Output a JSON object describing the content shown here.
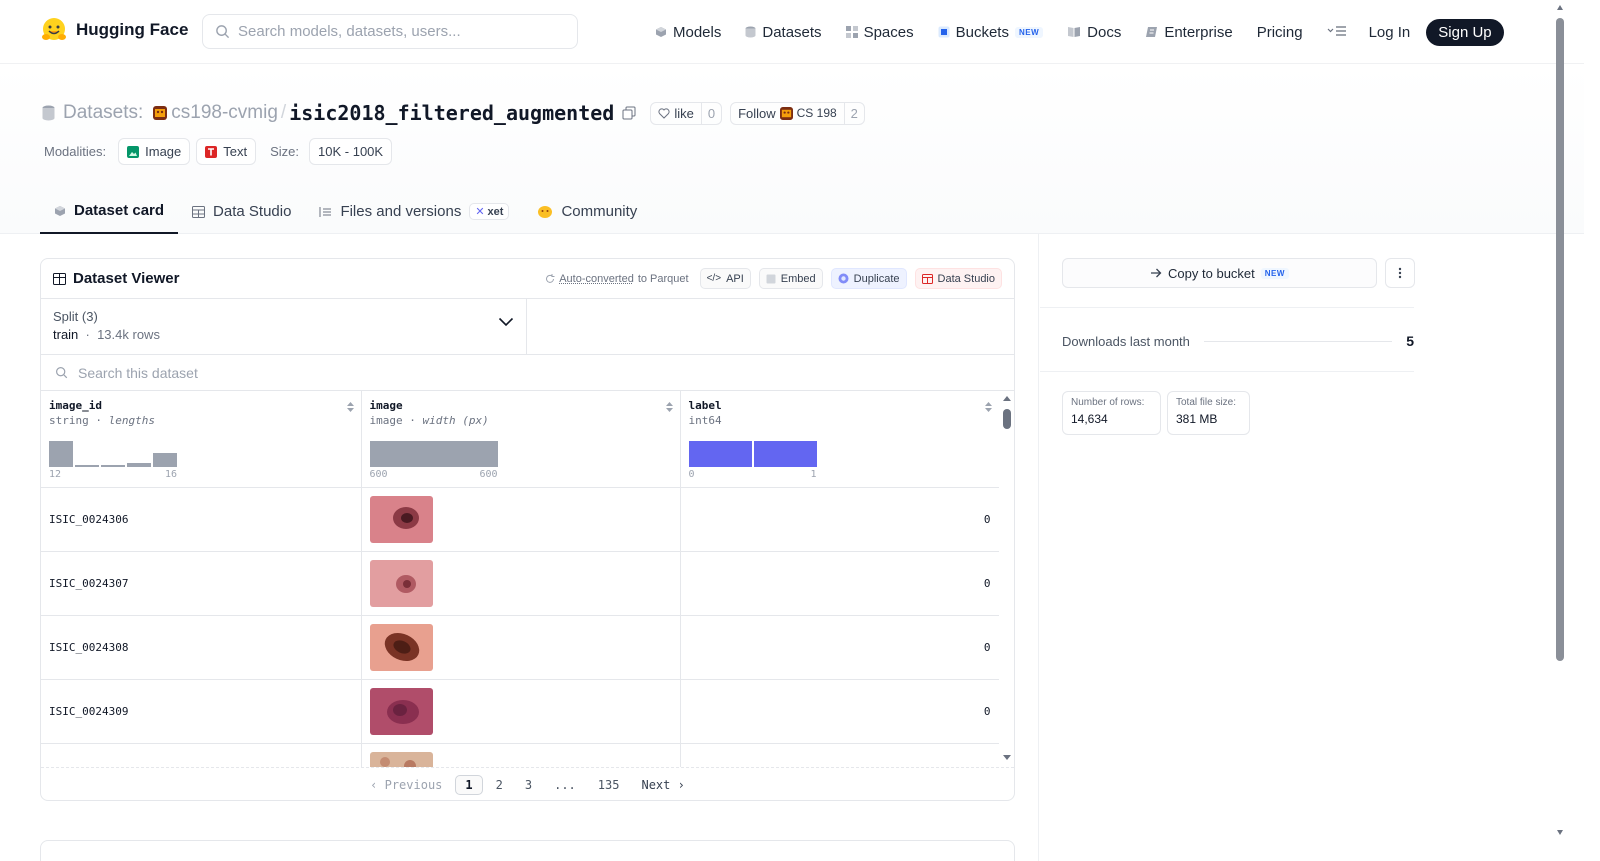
{
  "nav": {
    "brand": "Hugging Face",
    "search_placeholder": "Search models, datasets, users...",
    "links": [
      {
        "label": "Models",
        "icon": "cube-icon"
      },
      {
        "label": "Datasets",
        "icon": "database-icon"
      },
      {
        "label": "Spaces",
        "icon": "grid-icon"
      },
      {
        "label": "Buckets",
        "icon": "bucket-icon",
        "badge": "NEW"
      },
      {
        "label": "Docs",
        "icon": "book-icon"
      },
      {
        "label": "Enterprise",
        "icon": "enterprise-icon"
      },
      {
        "label": "Pricing"
      }
    ],
    "login": "Log In",
    "signup": "Sign Up"
  },
  "header": {
    "section": "Datasets:",
    "owner": "cs198-cvmig",
    "sep": "/",
    "name": "isic2018_filtered_augmented",
    "like_label": "like",
    "like_count": "0",
    "follow_label": "Follow",
    "org": "CS 198",
    "follow_count": "2",
    "modalities_label": "Modalities:",
    "modalities": [
      "Image",
      "Text"
    ],
    "size_label": "Size:",
    "size": "10K - 100K"
  },
  "tabs": [
    {
      "label": "Dataset card",
      "active": true
    },
    {
      "label": "Data Studio"
    },
    {
      "label": "Files and versions",
      "badge": "xet"
    },
    {
      "label": "Community"
    }
  ],
  "viewer": {
    "title": "Dataset Viewer",
    "auto_converted": "Auto-converted",
    "to_parquet": "to Parquet",
    "actions": [
      "API",
      "Embed",
      "Duplicate",
      "Data Studio"
    ],
    "split_label": "Split (3)",
    "split_name": "train",
    "split_rows": "13.4k rows",
    "search_placeholder": "Search this dataset",
    "columns": [
      {
        "name": "image_id",
        "type": "string",
        "stat": "lengths",
        "min": "12",
        "max": "16"
      },
      {
        "name": "image",
        "type": "image",
        "stat": "width (px)",
        "min": "600",
        "max": "600"
      },
      {
        "name": "label",
        "type": "int64",
        "stat": "",
        "min": "0",
        "max": "1"
      }
    ],
    "rows": [
      {
        "image_id": "ISIC_0024306",
        "label": "0"
      },
      {
        "image_id": "ISIC_0024307",
        "label": "0"
      },
      {
        "image_id": "ISIC_0024308",
        "label": "0"
      },
      {
        "image_id": "ISIC_0024309",
        "label": "0"
      },
      {
        "image_id": "",
        "label": ""
      }
    ],
    "pager": {
      "prev": "Previous",
      "pages": [
        "1",
        "2",
        "3",
        "...",
        "135"
      ],
      "next": "Next",
      "current": "1"
    }
  },
  "sidebar": {
    "copy_bucket": "Copy to bucket",
    "copy_badge": "NEW",
    "downloads_label": "Downloads last month",
    "downloads": "5",
    "rows_label": "Number of rows:",
    "rows": "14,634",
    "filesize_label": "Total file size:",
    "filesize": "381 MB"
  },
  "colors": {
    "accent": "#111827",
    "label_hist": "#6366f1",
    "hist": "#9ca3af",
    "badge_blue": "#2563eb"
  }
}
